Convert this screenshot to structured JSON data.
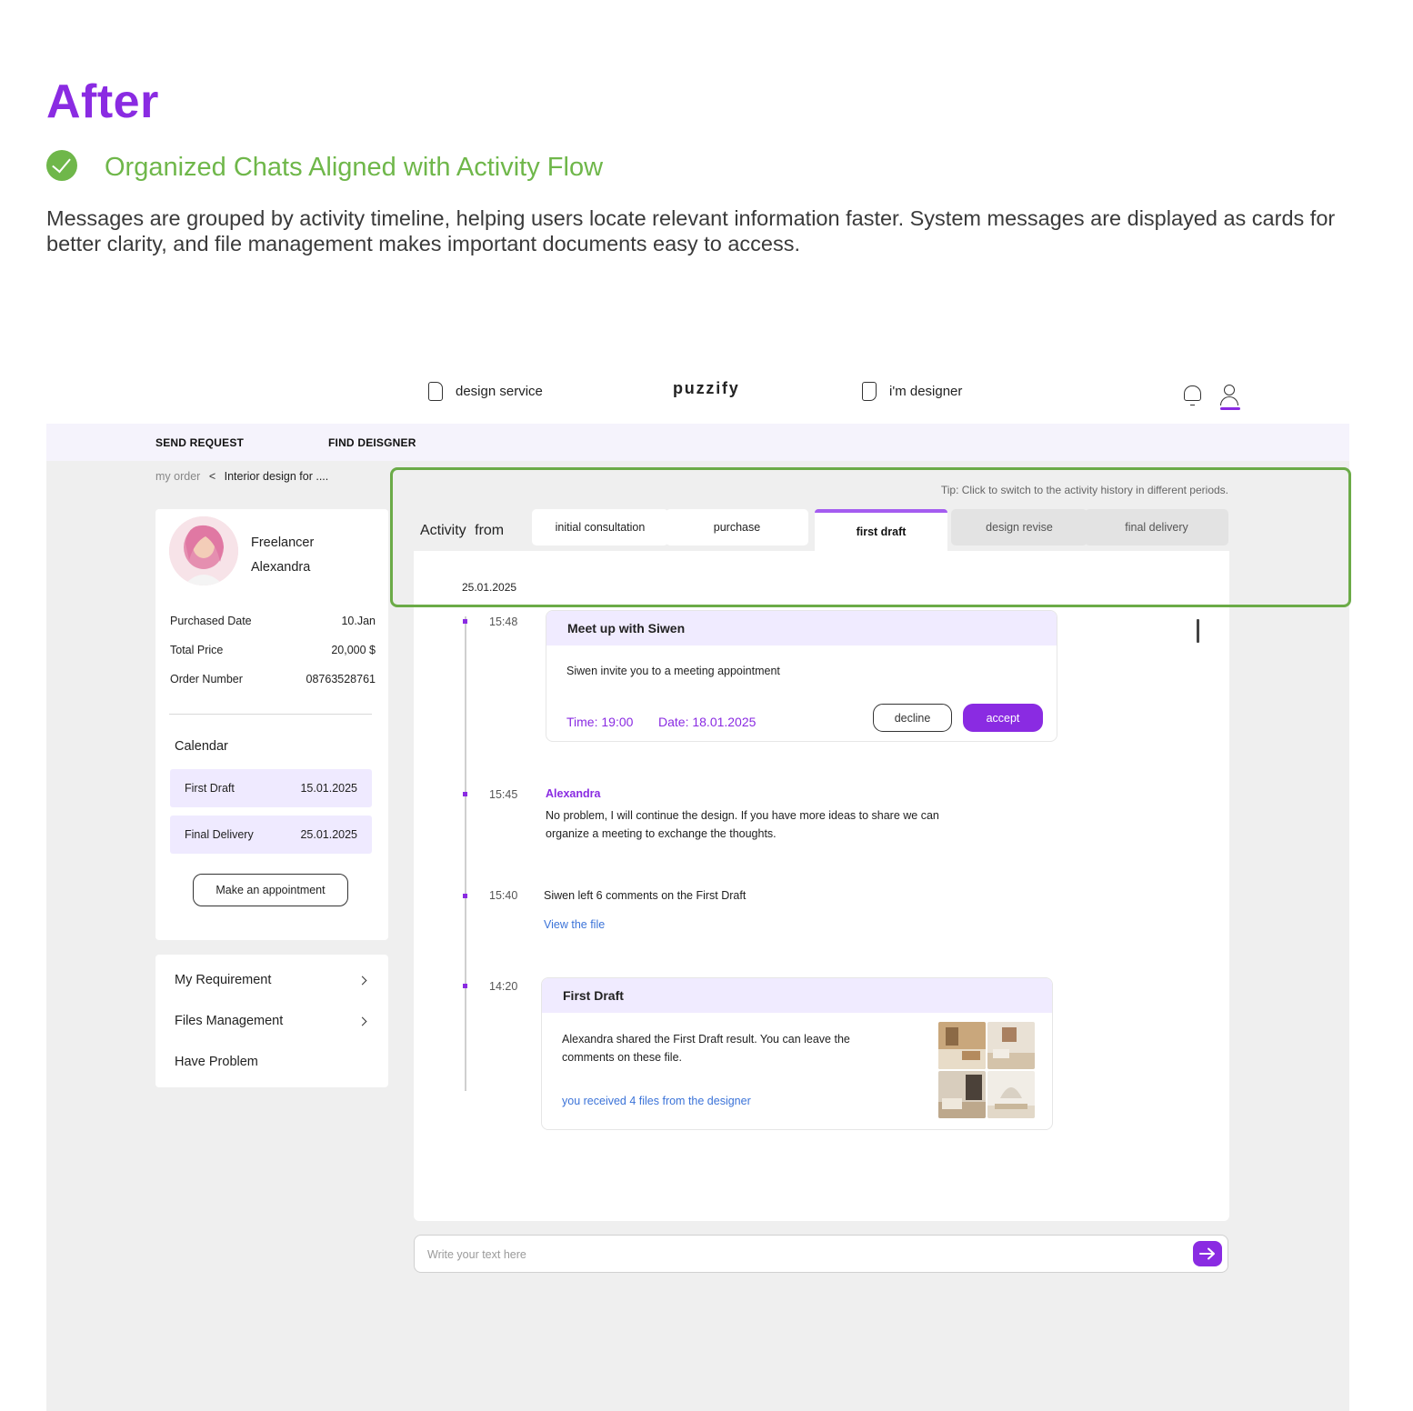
{
  "header": {
    "title": "After",
    "subtitle": "Organized Chats Aligned with Activity Flow",
    "description": "Messages are grouped by activity timeline, helping users locate relevant information faster. System messages are displayed as cards for better clarity, and file management makes important documents easy to access.",
    "accent_color": "#8a2be2",
    "success_color": "#6fb74a"
  },
  "topnav": {
    "design_service": "design service",
    "logo": "puzzify",
    "im_designer": "i'm designer"
  },
  "subnav": {
    "send_request": "SEND REQUEST",
    "find_designer": "FIND DEISGNER"
  },
  "breadcrumb": {
    "root": "my order",
    "separator": "<",
    "current": "Interior design for ...."
  },
  "profile": {
    "role": "Freelancer",
    "name": "Alexandra"
  },
  "order": {
    "purchased_label": "Purchased Date",
    "purchased_value": "10.Jan",
    "price_label": "Total Price",
    "price_value": "20,000 $",
    "number_label": "Order Number",
    "number_value": "08763528761"
  },
  "calendar": {
    "title": "Calendar",
    "items": [
      {
        "label": "First Draft",
        "date": "15.01.2025"
      },
      {
        "label": "Final Delivery",
        "date": "25.01.2025"
      }
    ],
    "appointment_button": "Make an appointment"
  },
  "menu": {
    "items": [
      {
        "label": "My Requirement"
      },
      {
        "label": "Files Management"
      },
      {
        "label": "Have Problem"
      }
    ]
  },
  "activity": {
    "tip": "Tip: Click to switch to the activity history in different periods.",
    "label": "Activity from",
    "tabs": [
      {
        "label": "initial consultation"
      },
      {
        "label": "purchase"
      },
      {
        "label": "first draft"
      },
      {
        "label": "design revise"
      },
      {
        "label": "final delivery"
      }
    ],
    "active_tab": "first draft",
    "date": "25.01.2025"
  },
  "timeline": {
    "meeting": {
      "time": "15:48",
      "title": "Meet up with Siwen",
      "body": "Siwen invite you to a meeting appointment",
      "time_label": "Time: 19:00",
      "date_label": "Date:  18.01.2025",
      "decline": "decline",
      "accept": "accept"
    },
    "message": {
      "time": "15:45",
      "sender": "Alexandra",
      "line1": "No problem, I will continue the design. If you have more ideas to share we can",
      "line2": "organize a meeting to exchange the thoughts."
    },
    "comments": {
      "time": "15:40",
      "text": "Siwen left 6 comments on the First Draft",
      "link": "View the file"
    },
    "draft": {
      "time": "14:20",
      "title": "First Draft",
      "line1": "Alexandra shared the First Draft result. You can leave the",
      "line2": "comments on these file.",
      "link": "you received 4 files from the designer"
    }
  },
  "composer": {
    "placeholder": "Write your text here"
  }
}
